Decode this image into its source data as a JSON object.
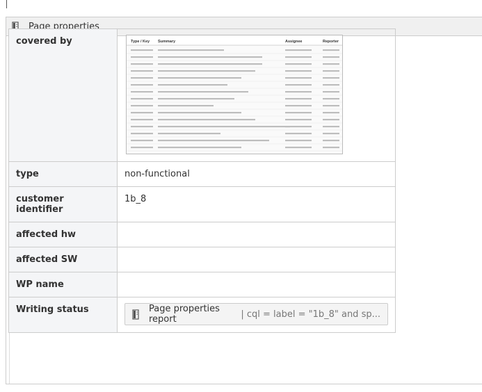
{
  "macro": {
    "title": "Page properties",
    "icon": "page-properties-icon"
  },
  "rows": [
    {
      "key": "covered by",
      "value": ""
    },
    {
      "key": "type",
      "value": "non-functional"
    },
    {
      "key": "customer identifier",
      "value": "1b_8"
    },
    {
      "key": "affected hw",
      "value": ""
    },
    {
      "key": "affected SW",
      "value": ""
    },
    {
      "key": "WP name",
      "value": ""
    },
    {
      "key": "Writing status",
      "value": ""
    }
  ],
  "jira_thumbnail": {
    "columns": [
      "Type / Key",
      "Summary",
      "Assignee",
      "Reporter"
    ]
  },
  "report_button": {
    "label": "Page properties report",
    "query": "| cql = label = \"1b_8\" and sp..."
  }
}
